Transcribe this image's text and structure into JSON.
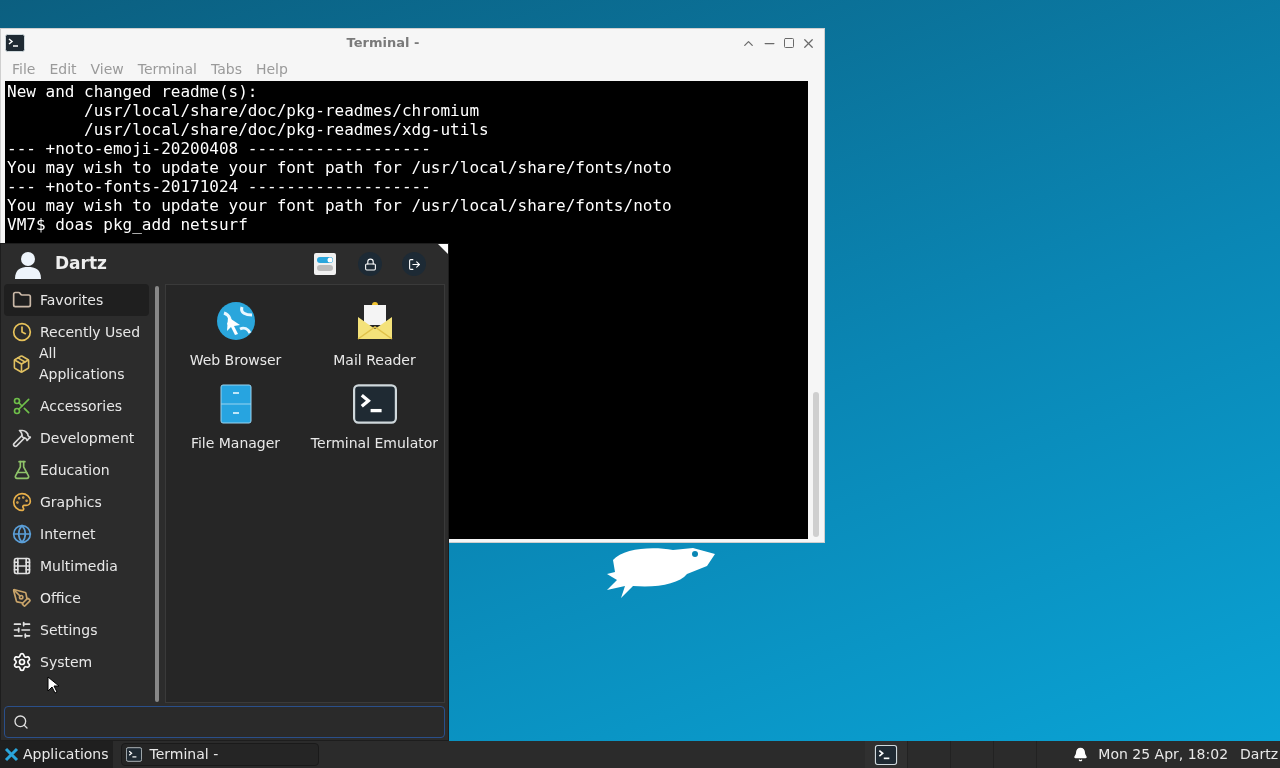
{
  "terminal_window": {
    "title": "Terminal -",
    "menu": [
      "File",
      "Edit",
      "View",
      "Terminal",
      "Tabs",
      "Help"
    ],
    "lines": [
      "New and changed readme(s):",
      "        /usr/local/share/doc/pkg-readmes/chromium",
      "        /usr/local/share/doc/pkg-readmes/xdg-utils",
      "--- +noto-emoji-20200408 -------------------",
      "You may wish to update your font path for /usr/local/share/fonts/noto",
      "--- +noto-fonts-20171024 -------------------",
      "You may wish to update your font path for /usr/local/share/fonts/noto",
      "VM7$ doas pkg_add netsurf"
    ]
  },
  "app_menu": {
    "user": "Dartz",
    "places": [
      {
        "label": "Favorites",
        "selected": true
      },
      {
        "label": "Recently Used",
        "selected": false
      },
      {
        "label": "All Applications",
        "selected": false
      }
    ],
    "categories": [
      {
        "label": "Accessories",
        "selected": false
      },
      {
        "label": "Development",
        "selected": false
      },
      {
        "label": "Education",
        "selected": false
      },
      {
        "label": "Graphics",
        "selected": false
      },
      {
        "label": "Internet",
        "selected": false
      },
      {
        "label": "Multimedia",
        "selected": false
      },
      {
        "label": "Office",
        "selected": false
      },
      {
        "label": "Settings",
        "selected": false
      },
      {
        "label": "System",
        "selected": false
      }
    ],
    "apps": [
      {
        "label": "Web Browser"
      },
      {
        "label": "Mail Reader"
      },
      {
        "label": "File Manager"
      },
      {
        "label": "Terminal Emulator"
      }
    ]
  },
  "taskbar": {
    "menu_button": "Applications",
    "tasks": [
      {
        "label": "Terminal -"
      }
    ],
    "workspaces": [
      {
        "selected": true
      },
      {
        "selected": false
      },
      {
        "selected": false
      },
      {
        "selected": false
      }
    ],
    "clock": "Mon 25 Apr, 18:02",
    "user": "Dartz"
  }
}
